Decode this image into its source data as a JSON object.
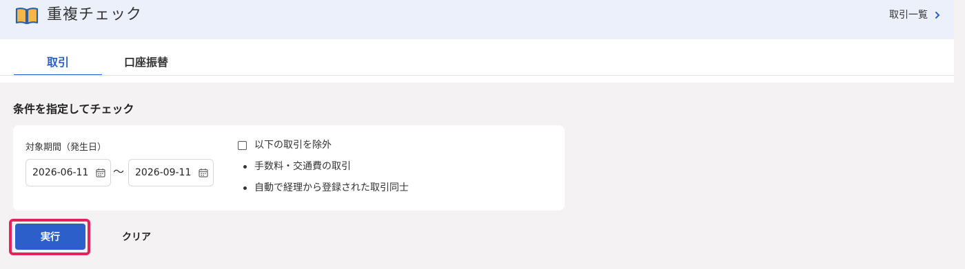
{
  "header": {
    "title": "重複チェック",
    "icon": "book-open-icon",
    "list_link_label": "取引一覧",
    "list_link_icon": "chevron-right-icon",
    "background": "#ebf0fa"
  },
  "tabs": [
    {
      "label": "取引",
      "active": true
    },
    {
      "label": "口座振替",
      "active": false
    }
  ],
  "section": {
    "title": "条件を指定してチェック"
  },
  "filters": {
    "period_label": "対象期間（発生日）",
    "date_from": "2026-06-11",
    "date_to": "2026-09-11",
    "separator": "〜",
    "calendar_icon": "calendar-icon",
    "exclude_label": "以下の取引を除外",
    "exclude_checked": false,
    "exclude_items": [
      "手数料・交通費の取引",
      "自動で経理から登録された取引同士"
    ]
  },
  "actions": {
    "run_label": "実行",
    "clear_label": "クリア",
    "accent_color": "#2c5fc9",
    "highlight_color": "#e8205c"
  }
}
